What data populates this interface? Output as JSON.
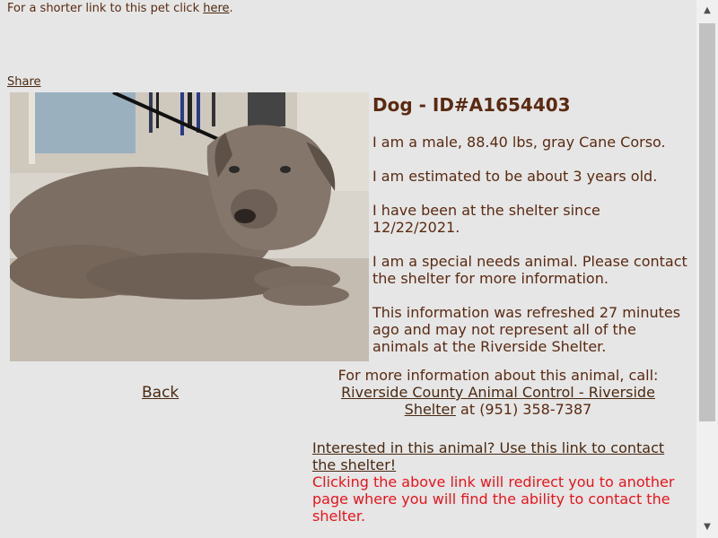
{
  "shorter_link": {
    "prefix": "For a shorter link to this pet click ",
    "link": "here",
    "suffix": "."
  },
  "share": "Share",
  "pet": {
    "heading": "Dog - ID#A1654403",
    "line1": "I am a male, 88.40 lbs, gray Cane Corso.",
    "line2": "I am estimated to be about 3 years old.",
    "line3": "I have been at the shelter since 12/22/2021.",
    "line4": "I am a special needs animal. Please contact the shelter for more information.",
    "line5": "This information was refreshed 27 minutes ago and may not represent all of the animals at the Riverside Shelter."
  },
  "back": "Back",
  "contact": {
    "intro": "For more information about this animal, call:",
    "shelter_link": "Riverside County Animal Control - Riverside Shelter",
    "phone": " at (951) 358-7387"
  },
  "interest": {
    "link": "Interested in this animal? Use this link to contact the shelter!",
    "note": "Clicking the above link will redirect you to another page where you will find the ability to contact the shelter."
  },
  "colors": {
    "text": "#5a2a12",
    "warning": "#e8141c",
    "background": "#e6e6e6"
  },
  "icons": {
    "scroll_up": "scroll-up-arrow-icon",
    "scroll_down": "scroll-down-arrow-icon"
  }
}
